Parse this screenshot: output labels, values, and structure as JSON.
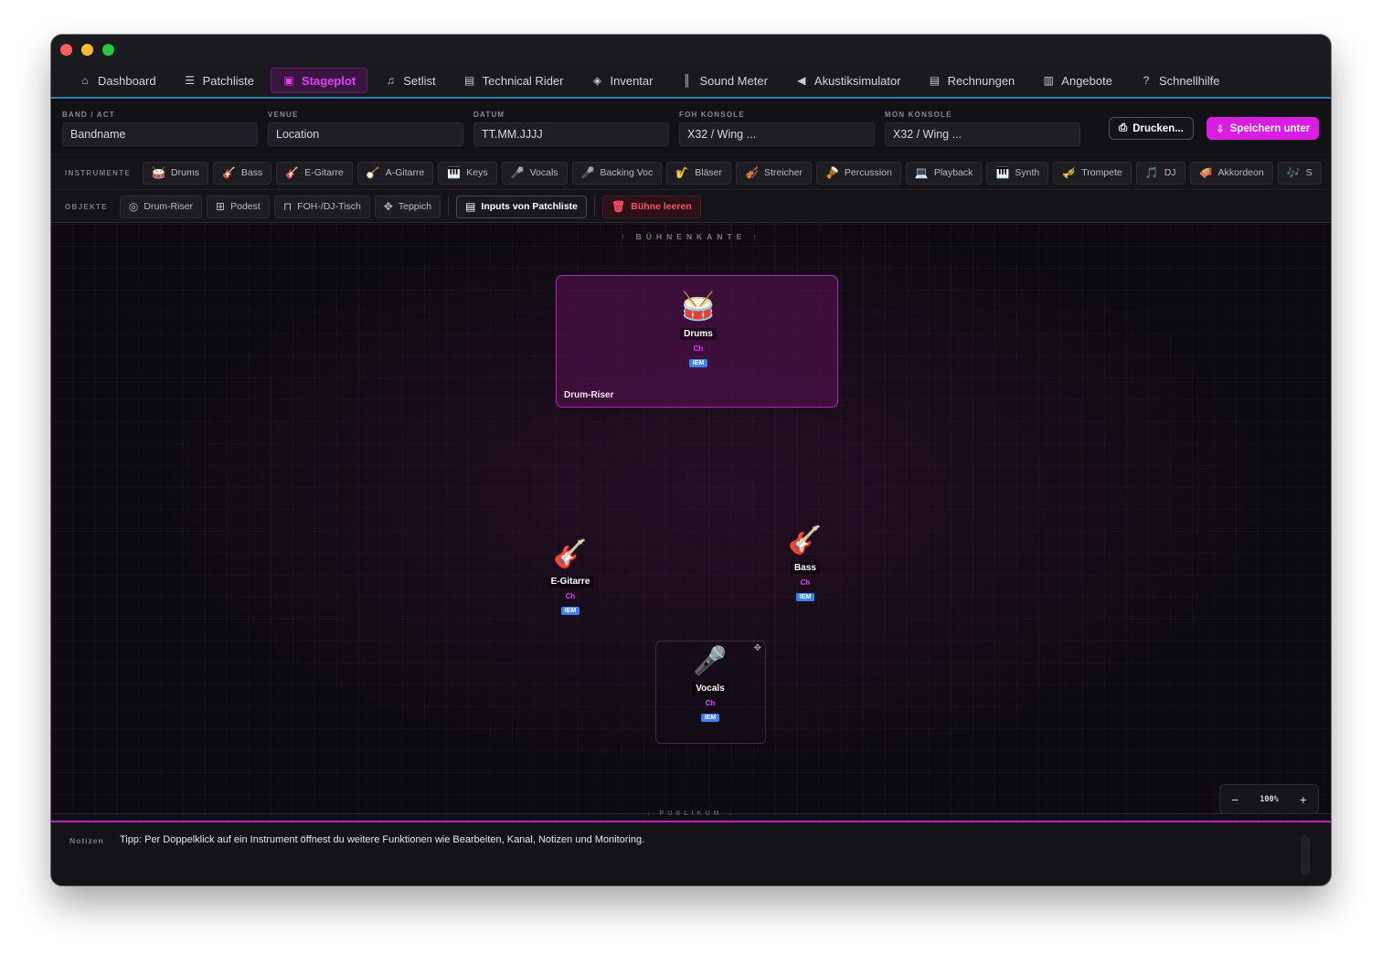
{
  "nav": {
    "items": [
      {
        "label": "Dashboard",
        "icon": "home-icon",
        "glyph": "⌂",
        "active": false
      },
      {
        "label": "Patchliste",
        "icon": "list-icon",
        "glyph": "☰",
        "active": false
      },
      {
        "label": "Stageplot",
        "icon": "stage-icon",
        "glyph": "▣",
        "active": true
      },
      {
        "label": "Setlist",
        "icon": "music-list-icon",
        "glyph": "♫",
        "active": false
      },
      {
        "label": "Technical Rider",
        "icon": "document-icon",
        "glyph": "▤",
        "active": false
      },
      {
        "label": "Inventar",
        "icon": "box-icon",
        "glyph": "◈",
        "active": false
      },
      {
        "label": "Sound Meter",
        "icon": "waveform-icon",
        "glyph": "║",
        "active": false
      },
      {
        "label": "Akustiksimulator",
        "icon": "speaker-icon",
        "glyph": "◀",
        "active": false
      },
      {
        "label": "Rechnungen",
        "icon": "invoice-icon",
        "glyph": "▤",
        "active": false
      },
      {
        "label": "Angebote",
        "icon": "offer-icon",
        "glyph": "▥",
        "active": false
      },
      {
        "label": "Schnellhilfe",
        "icon": "help-icon",
        "glyph": "?",
        "active": false
      }
    ]
  },
  "fields": {
    "band": {
      "label": "BAND / ACT",
      "placeholder": "Bandname"
    },
    "venue": {
      "label": "VENUE",
      "placeholder": "Location"
    },
    "datum": {
      "label": "DATUM",
      "placeholder": "TT.MM.JJJJ"
    },
    "foh": {
      "label": "FOH KONSOLE",
      "placeholder": "X32 / Wing ..."
    },
    "mon": {
      "label": "MON KONSOLE",
      "placeholder": "X32 / Wing ..."
    }
  },
  "actions": {
    "print": "Drucken...",
    "save": "Speichern unter"
  },
  "instruments": {
    "label": "INSTRUMENTE",
    "items": [
      {
        "label": "Drums",
        "emoji": "🥁"
      },
      {
        "label": "Bass",
        "emoji": "🎸"
      },
      {
        "label": "E-Gitarre",
        "emoji": "🎸"
      },
      {
        "label": "A-Gitarre",
        "emoji": "🪕"
      },
      {
        "label": "Keys",
        "emoji": "🎹"
      },
      {
        "label": "Vocals",
        "emoji": "🎤"
      },
      {
        "label": "Backing Voc",
        "emoji": "🎤"
      },
      {
        "label": "Bläser",
        "emoji": "🎷"
      },
      {
        "label": "Streicher",
        "emoji": "🎻"
      },
      {
        "label": "Percussion",
        "emoji": "🪘"
      },
      {
        "label": "Playback",
        "emoji": "💻"
      },
      {
        "label": "Synth",
        "emoji": "🎹"
      },
      {
        "label": "Trompete",
        "emoji": "🎺"
      },
      {
        "label": "DJ",
        "emoji": "🎵"
      },
      {
        "label": "Akkordeon",
        "emoji": "🪗"
      },
      {
        "label": "S",
        "emoji": "🎶"
      }
    ]
  },
  "objects": {
    "label": "OBJEKTE",
    "items": [
      {
        "label": "Drum-Riser",
        "glyph": "◎"
      },
      {
        "label": "Podest",
        "glyph": "⊞"
      },
      {
        "label": "FOH-/DJ-Tisch",
        "glyph": "⊓"
      },
      {
        "label": "Teppich",
        "glyph": "✥"
      }
    ],
    "inputs": "Inputs von Patchliste",
    "clear": "Bühne leeren"
  },
  "stage": {
    "edge": "↑ BÜHNENKANTE ↑",
    "audience": "↓ PUBLIKUM ↓",
    "riser_label": "Drum-Riser",
    "instruments": [
      {
        "name": "Drums",
        "emoji": "🥁",
        "ch": "Ch",
        "badge": "IEM"
      },
      {
        "name": "E-Gitarre",
        "emoji": "🎸",
        "ch": "Ch",
        "badge": "IEM"
      },
      {
        "name": "Bass",
        "emoji": "🎸",
        "ch": "Ch",
        "badge": "IEM"
      },
      {
        "name": "Vocals",
        "emoji": "🎤",
        "ch": "Ch",
        "badge": "IEM"
      }
    ]
  },
  "zoom": {
    "minus": "−",
    "value": "100%",
    "plus": "+"
  },
  "notes": {
    "label": "Notizen",
    "text": "Tipp: Per Doppelklick auf ein Instrument öffnest du weitere Funktionen wie Bearbeiten, Kanal, Notizen und Monitoring."
  },
  "colors": {
    "accent": "#e040fb",
    "save_button": "#d81ee0",
    "nav_underline": "#2a7fb8",
    "iem_badge": "#3b82f6",
    "danger": "#ff4d6a"
  }
}
